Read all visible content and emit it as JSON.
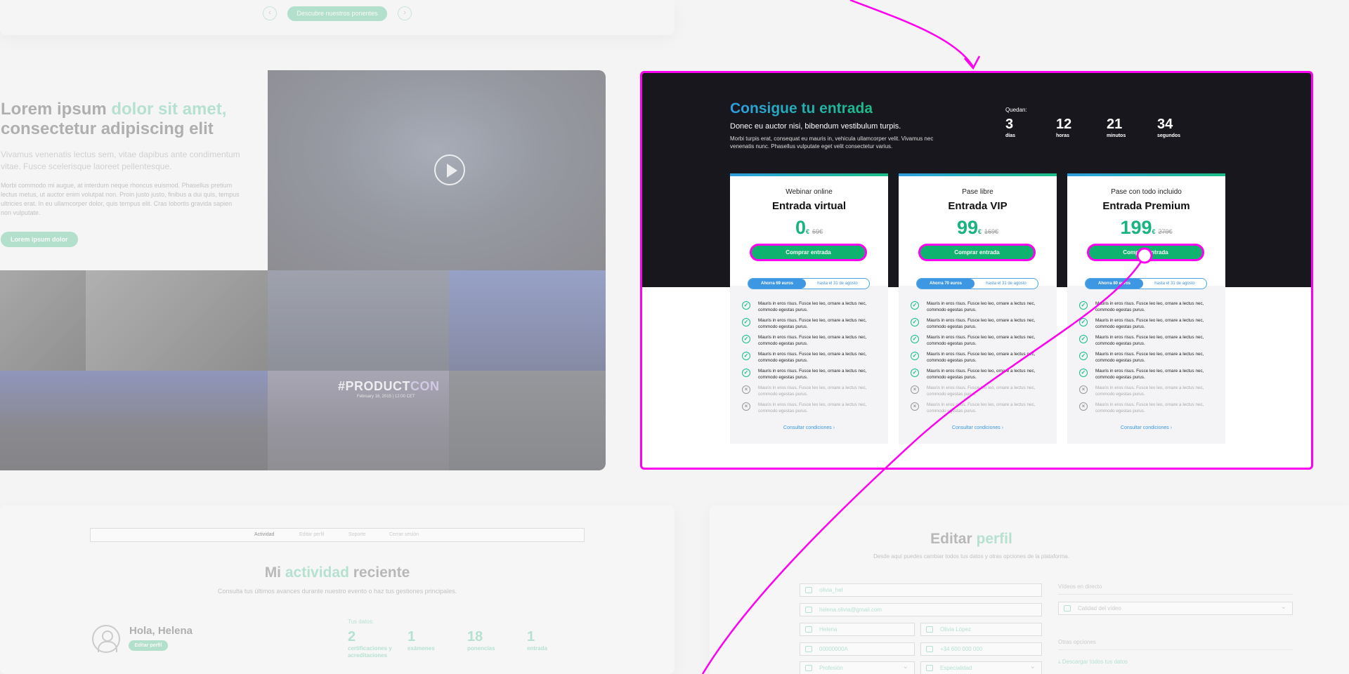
{
  "top": {
    "speakers_button": "Descubre nuestros ponentes",
    "prev": "‹",
    "next": "›"
  },
  "hero": {
    "title_part1": "Lorem ipsum ",
    "title_accent": "dolor sit amet,",
    "title_part2": "consectetur adipiscing elit",
    "subtitle": "Vivamus venenatis lectus sem, vitae dapibus ante condimentum vitae. Fusce scelerisque laoreet pellentesque.",
    "body": "Morbi commodo mi augue, at interdum neque rhoncus euismod. Phasellus pretium lectus metus, ut auctor enim volutpat non. Proin justo justo, finibus a dui quis, tempus ultricies erat. In eu ullamcorper dolor, quis tempus elit. Cras lobortis gravida sapien non vulputate.",
    "button": "Lorem ipsum dolor",
    "product_text_1": "#PRODUCT",
    "product_text_2": "CON",
    "product_date": "February 16, 2015 | 12:00 CET"
  },
  "pricing": {
    "title": "Consigue tu entrada",
    "subtitle": "Donec eu auctor nisi, bibendum vestibulum turpis.",
    "description": "Morbi turpis erat, consequat eu mauris in, vehicula ullamcorper velit. Vivamus nec venenatis nunc. Phasellus vulputate eget velit consectetur varius.",
    "countdown_label": "Quedan:",
    "countdown": [
      {
        "value": "3",
        "unit": "días"
      },
      {
        "value": "12",
        "unit": "horas"
      },
      {
        "value": "21",
        "unit": "minutos"
      },
      {
        "value": "34",
        "unit": "segundos"
      }
    ],
    "tickets": [
      {
        "kicker": "Webinar online",
        "name": "Entrada virtual",
        "price": "0",
        "currency": "€",
        "old_price": "69€",
        "buy": "Comprar entrada",
        "save": "Ahorra 69 euros",
        "until": "hasta el 31 de agosto",
        "features": [
          {
            "text": "Mauris in eros risus. Fusce leo leo, ornare a lectus nec, commodo egestas purus.",
            "included": true
          },
          {
            "text": "Mauris in eros risus. Fusce leo leo, ornare a lectus nec, commodo egestas purus.",
            "included": true
          },
          {
            "text": "Mauris in eros risus. Fusce leo leo, ornare a lectus nec, commodo egestas purus.",
            "included": true
          },
          {
            "text": "Mauris in eros risus. Fusce leo leo, ornare a lectus nec, commodo egestas purus.",
            "included": true
          },
          {
            "text": "Mauris in eros risus. Fusce leo leo, ornare a lectus nec, commodo egestas purus.",
            "included": true
          },
          {
            "text": "Mauris in eros risus. Fusce leo leo, ornare a lectus nec, commodo egestas purus.",
            "included": false
          },
          {
            "text": "Mauris in eros risus. Fusce leo leo, ornare a lectus nec, commodo egestas purus.",
            "included": false
          }
        ],
        "link": "Consultar condiciones"
      },
      {
        "kicker": "Pase libre",
        "name": "Entrada VIP",
        "price": "99",
        "currency": "€",
        "old_price": "169€",
        "buy": "Comprar entrada",
        "save": "Ahorra 70 euros",
        "until": "hasta el 31 de agosto",
        "features": [
          {
            "text": "Mauris in eros risus. Fusce leo leo, ornare a lectus nec, commodo egestas purus.",
            "included": true
          },
          {
            "text": "Mauris in eros risus. Fusce leo leo, ornare a lectus nec, commodo egestas purus.",
            "included": true
          },
          {
            "text": "Mauris in eros risus. Fusce leo leo, ornare a lectus nec, commodo egestas purus.",
            "included": true
          },
          {
            "text": "Mauris in eros risus. Fusce leo leo, ornare a lectus nec, commodo egestas purus.",
            "included": true
          },
          {
            "text": "Mauris in eros risus. Fusce leo leo, ornare a lectus nec, commodo egestas purus.",
            "included": true
          },
          {
            "text": "Mauris in eros risus. Fusce leo leo, ornare a lectus nec, commodo egestas purus.",
            "included": false
          },
          {
            "text": "Mauris in eros risus. Fusce leo leo, ornare a lectus nec, commodo egestas purus.",
            "included": false
          }
        ],
        "link": "Consultar condiciones"
      },
      {
        "kicker": "Pase con todo incluido",
        "name": "Entrada Premium",
        "price": "199",
        "currency": "€",
        "old_price": "279€",
        "buy": "Comprar entrada",
        "save": "Ahorra 80 euros",
        "until": "hasta el 31 de agosto",
        "features": [
          {
            "text": "Mauris in eros risus. Fusce leo leo, ornare a lectus nec, commodo egestas purus.",
            "included": true
          },
          {
            "text": "Mauris in eros risus. Fusce leo leo, ornare a lectus nec, commodo egestas purus.",
            "included": true
          },
          {
            "text": "Mauris in eros risus. Fusce leo leo, ornare a lectus nec, commodo egestas purus.",
            "included": true
          },
          {
            "text": "Mauris in eros risus. Fusce leo leo, ornare a lectus nec, commodo egestas purus.",
            "included": true
          },
          {
            "text": "Mauris in eros risus. Fusce leo leo, ornare a lectus nec, commodo egestas purus.",
            "included": true
          },
          {
            "text": "Mauris in eros risus. Fusce leo leo, ornare a lectus nec, commodo egestas purus.",
            "included": false
          },
          {
            "text": "Mauris in eros risus. Fusce leo leo, ornare a lectus nec, commodo egestas purus.",
            "included": false
          }
        ],
        "link": "Consultar condiciones"
      }
    ]
  },
  "activity": {
    "tabs": [
      "Actividad",
      "Editar perfil",
      "Soporte",
      "Cerrar sesión"
    ],
    "title_part1": "Mi ",
    "title_accent": "actividad",
    "title_part2": " reciente",
    "subtitle": "Consulta tus últimos avances durante nuestro evento o haz tus gestiones principales.",
    "greeting": "Hola, Helena",
    "edit_button": "Editar perfil",
    "data_label": "Tus datos:",
    "stats": [
      {
        "value": "2",
        "label": "certificaciones y acreditaciones"
      },
      {
        "value": "1",
        "label": "exámenes"
      },
      {
        "value": "18",
        "label": "ponencias"
      },
      {
        "value": "1",
        "label": "entrada"
      }
    ]
  },
  "profile": {
    "title_part1": "Editar ",
    "title_accent": "perfil",
    "subtitle": "Desde aquí puedes cambiar todos tus datos y otras opciones de la plataforma.",
    "username": "olivia_hel",
    "email": "helena.olivia@gmail.com",
    "first_name": "Helena",
    "last_name": "Olivia López",
    "id_number": "00000000A",
    "phone": "+34 600 000 000",
    "profession": "Profesión",
    "specialty": "Especialidad",
    "video_label": "Vídeos en directo",
    "video_quality": "Calidad del vídeo",
    "other_label": "Otras opciones",
    "download": "Descargar todos tus datos"
  },
  "colors": {
    "accent": "#17b47e",
    "annotation": "#ff00f0",
    "dark": "#17171d",
    "blue": "#3d97e2"
  }
}
